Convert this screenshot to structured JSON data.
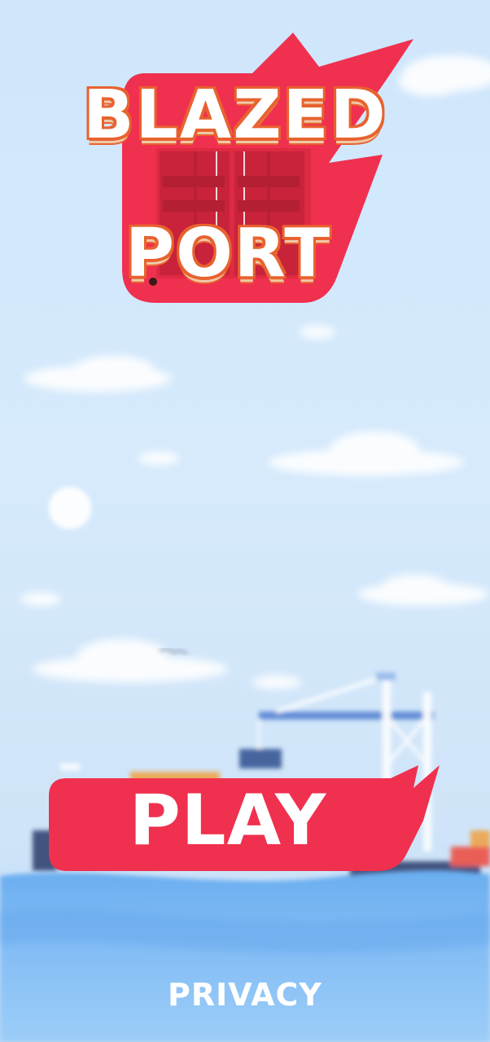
{
  "logo": {
    "line1": "BLAZED",
    "line2": "PORT"
  },
  "buttons": {
    "play_label": "PLAY",
    "privacy_label": "PRIVACY"
  },
  "colors": {
    "brand_red": "#f0304f",
    "logo_outline": "#e8622f",
    "sky": "#d6eafc",
    "sea": "#7fbaf2"
  }
}
